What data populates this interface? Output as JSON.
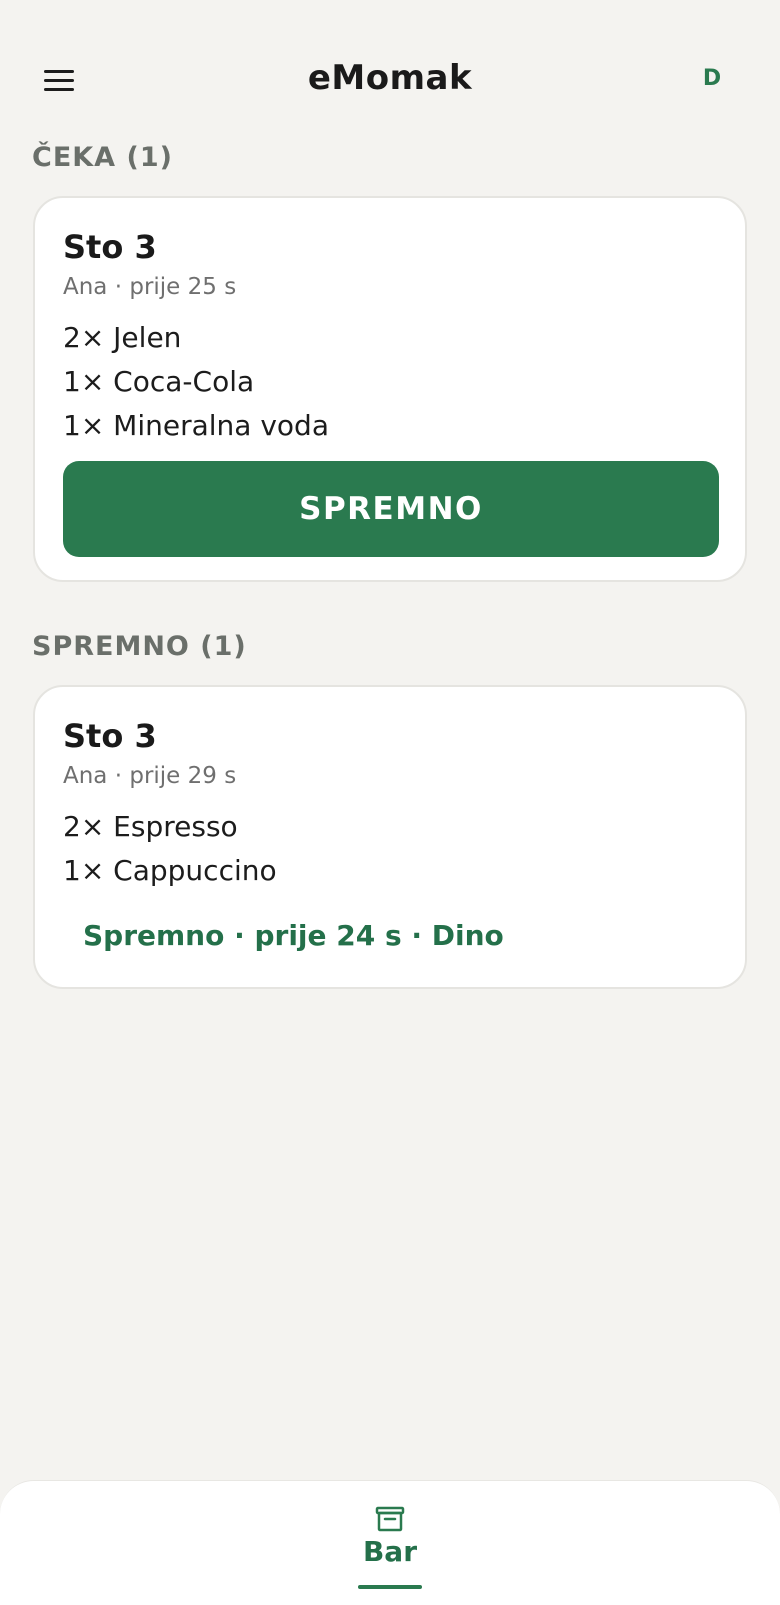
{
  "header": {
    "menu_icon": "hamburger-menu-icon",
    "title": "eMomak",
    "user_initial": "D"
  },
  "sections": {
    "waiting": {
      "title": "ČEKA (1)",
      "order": {
        "table": "Sto 3",
        "meta": "Ana · prije 25 s",
        "items": [
          "2× Jelen",
          "1× Coca-Cola",
          "1× Mineralna voda"
        ],
        "action_label": "SPREMNO"
      }
    },
    "ready": {
      "title": "SPREMNO (1)",
      "order": {
        "table": "Sto 3",
        "meta": "Ana · prije 29 s",
        "items": [
          "2× Espresso",
          "1× Cappuccino"
        ],
        "status": "Spremno · prije 24 s · Dino"
      }
    }
  },
  "bottom_nav": {
    "items": [
      {
        "label": "Bar",
        "icon": "bar-tray-icon",
        "active": true
      }
    ]
  },
  "colors": {
    "accent": "#2a7a4f",
    "background": "#f4f3f0",
    "card": "#ffffff",
    "section_title": "#6a6f6a"
  }
}
